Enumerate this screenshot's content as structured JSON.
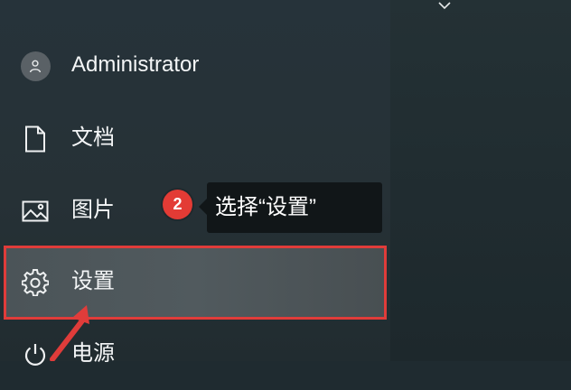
{
  "start_menu": {
    "user": {
      "name": "Administrator",
      "icon": "user-icon"
    },
    "items": [
      {
        "label": "文档",
        "icon": "document-icon"
      },
      {
        "label": "图片",
        "icon": "picture-icon"
      },
      {
        "label": "设置",
        "icon": "gear-icon",
        "highlighted": true
      },
      {
        "label": "电源",
        "icon": "power-icon"
      }
    ]
  },
  "annotation": {
    "step_number": "2",
    "tooltip_text": "选择“设置”",
    "accent_color": "#e03c3a"
  },
  "tiles": {
    "chevron_icon": "chevron-down-icon"
  }
}
